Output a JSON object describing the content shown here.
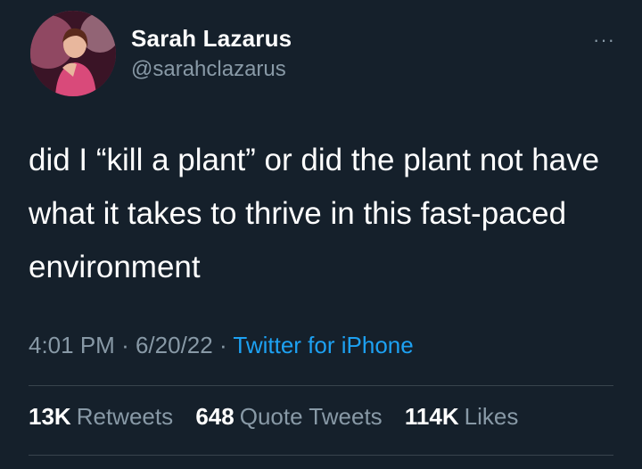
{
  "user": {
    "name": "Sarah Lazarus",
    "handle": "@sarahclazarus"
  },
  "menu": {
    "more_label": "···"
  },
  "tweet": {
    "text": "did I “kill a plant” or did the plant not have what it takes to thrive in this fast-paced environment",
    "time": "4:01 PM",
    "separator": "·",
    "date": "6/20/22",
    "source": "Twitter for iPhone"
  },
  "stats": {
    "retweets_count": "13K",
    "retweets_label": "Retweets",
    "quotes_count": "648",
    "quotes_label": "Quote Tweets",
    "likes_count": "114K",
    "likes_label": "Likes"
  },
  "colors": {
    "background": "#15202b",
    "text_primary": "#ffffff",
    "text_secondary": "#8899a6",
    "link": "#1da1f2",
    "divider": "#38444d"
  }
}
